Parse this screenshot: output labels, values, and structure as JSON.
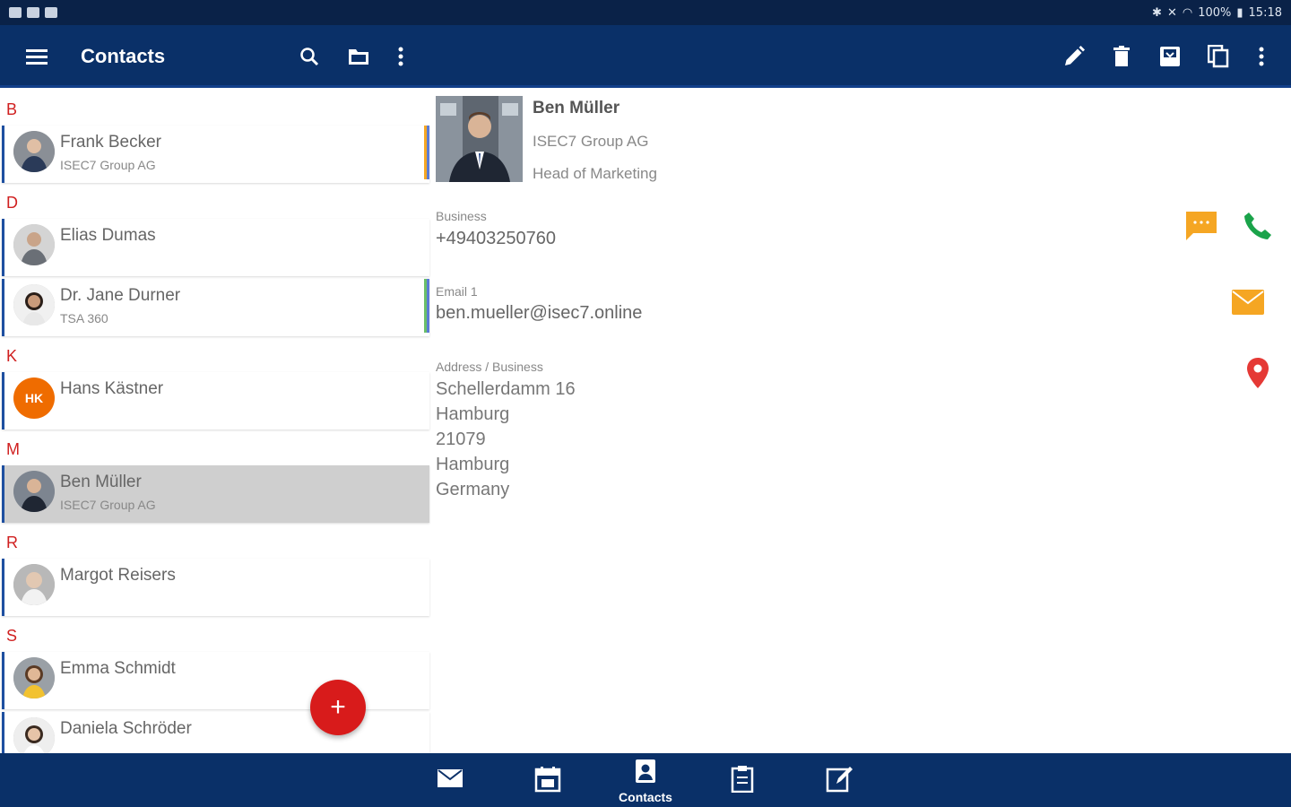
{
  "status": {
    "battery": "100%",
    "time": "15:18"
  },
  "appbar": {
    "title": "Contacts"
  },
  "sections": [
    {
      "letter": "B"
    },
    {
      "letter": "D"
    },
    {
      "letter": "K"
    },
    {
      "letter": "M"
    },
    {
      "letter": "R"
    },
    {
      "letter": "S"
    }
  ],
  "contacts": [
    {
      "name": "Frank Becker",
      "company": "ISEC7 Group AG",
      "stripe_color": "#f5a623"
    },
    {
      "name": "Elias Dumas",
      "company": ""
    },
    {
      "name": "Dr.  Jane Durner",
      "company": "TSA 360",
      "stripe_color": "#6abf69"
    },
    {
      "name": "Hans Kästner",
      "company": "",
      "initials": "HK"
    },
    {
      "name": "Ben Müller",
      "company": "ISEC7 Group AG"
    },
    {
      "name": "Margot Reisers",
      "company": ""
    },
    {
      "name": "Emma Schmidt",
      "company": ""
    },
    {
      "name": "Daniela Schröder",
      "company": ""
    }
  ],
  "fab": {
    "label": "+"
  },
  "detail": {
    "name": "Ben Müller",
    "company": "ISEC7 Group AG",
    "job_title": "Head of Marketing",
    "phone_label": "Business",
    "phone_value": "+49403250760",
    "email_label": "Email 1",
    "email_value": "ben.mueller@isec7.online",
    "address_label": "Address / Business",
    "address_lines": [
      "Schellerdamm 16",
      "Hamburg",
      "21079",
      "Hamburg",
      "Germany"
    ]
  },
  "colors": {
    "appbar": "#0a3068",
    "accent_red": "#d81b1b",
    "section_letter": "#d02020",
    "message": "#f5a623",
    "call": "#1aa34a",
    "location": "#e53935"
  },
  "bottom_tabs": [
    {
      "icon": "mail-icon",
      "label": ""
    },
    {
      "icon": "calendar-icon",
      "label": ""
    },
    {
      "icon": "contacts-icon",
      "label": "Contacts"
    },
    {
      "icon": "tasks-icon",
      "label": ""
    },
    {
      "icon": "notes-icon",
      "label": ""
    }
  ]
}
